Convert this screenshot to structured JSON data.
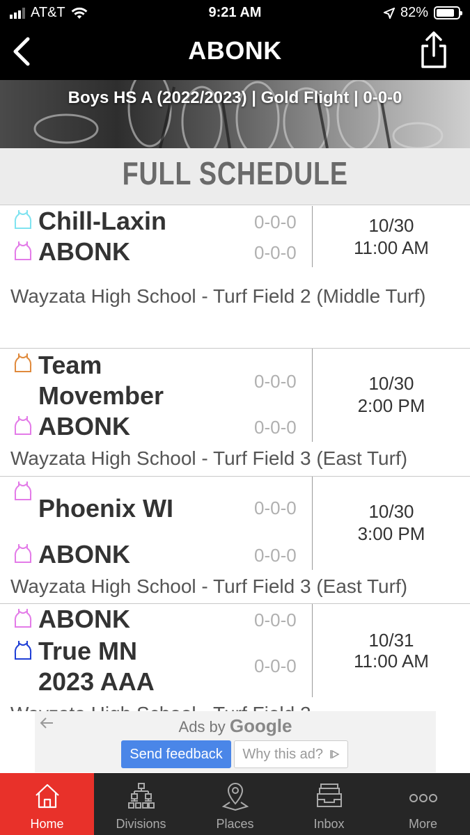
{
  "status": {
    "carrier": "AT&T",
    "time": "9:21 AM",
    "battery": "82%",
    "battery_level": 0.82
  },
  "nav": {
    "title": "ABONK"
  },
  "hero": {
    "subtitle": "Boys HS A (2022/2023) | Gold Flight | 0-0-0"
  },
  "section": {
    "title": "FULL SCHEDULE"
  },
  "colors": {
    "accent": "#e8312a",
    "jersey_cyan": "#7fe3f0",
    "jersey_pink": "#e37be8",
    "jersey_orange": "#e08a3c",
    "jersey_blue": "#1f3fd6"
  },
  "games": [
    {
      "home": {
        "name": "Chill-Laxin",
        "record": "0-0-0",
        "jersey": "jersey-icon"
      },
      "away": {
        "name": "ABONK",
        "record": "0-0-0",
        "jersey": "jersey-icon"
      },
      "date": "10/30",
      "time": "11:00 AM",
      "venue": "Wayzata High School - Turf Field 2 (Middle Turf)"
    },
    {
      "home": {
        "name": "Team Movember",
        "record": "0-0-0",
        "jersey": "jersey-icon"
      },
      "away": {
        "name": "ABONK",
        "record": "0-0-0",
        "jersey": "jersey-icon"
      },
      "date": "10/30",
      "time": "2:00 PM",
      "venue": "Wayzata High School - Turf Field 3 (East Turf)"
    },
    {
      "home": {
        "name": "Phoenix WI",
        "record": "0-0-0",
        "jersey": "jersey-icon"
      },
      "away": {
        "name": "ABONK",
        "record": "0-0-0",
        "jersey": "jersey-icon"
      },
      "date": "10/30",
      "time": "3:00 PM",
      "venue": "Wayzata High School - Turf Field 3 (East Turf)"
    },
    {
      "home": {
        "name": "ABONK",
        "record": "0-0-0",
        "jersey": "jersey-icon"
      },
      "away": {
        "name": "True MN 2023 AAA",
        "record": "0-0-0",
        "jersey": "jersey-icon"
      },
      "date": "10/31",
      "time": "11:00 AM",
      "venue": "Wayzata High School - Turf Field 2"
    }
  ],
  "ad": {
    "ads_by": "Ads by",
    "google": "Google",
    "feedback": "Send feedback",
    "why": "Why this ad?"
  },
  "tabs": [
    {
      "label": "Home",
      "icon": "home-icon"
    },
    {
      "label": "Divisions",
      "icon": "bracket-icon"
    },
    {
      "label": "Places",
      "icon": "map-pin-icon"
    },
    {
      "label": "Inbox",
      "icon": "inbox-icon"
    },
    {
      "label": "More",
      "icon": "more-dots-icon"
    }
  ]
}
